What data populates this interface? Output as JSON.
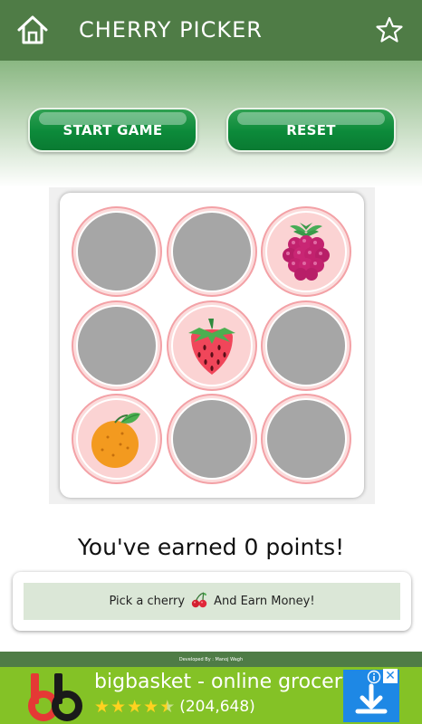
{
  "header": {
    "title": "CHERRY PICKER",
    "home_icon": "home-icon",
    "star_icon": "star-outline-icon",
    "background": "#4f7c46"
  },
  "controls": {
    "start_label": "START GAME",
    "reset_label": "RESET",
    "accent": "#0c8a3a"
  },
  "board": {
    "cells": [
      {
        "state": "hidden"
      },
      {
        "state": "hidden"
      },
      {
        "state": "revealed",
        "fruit": "raspberry"
      },
      {
        "state": "hidden"
      },
      {
        "state": "revealed",
        "fruit": "strawberry"
      },
      {
        "state": "hidden"
      },
      {
        "state": "revealed",
        "fruit": "orange"
      },
      {
        "state": "hidden"
      },
      {
        "state": "hidden"
      }
    ]
  },
  "score_text": "You've earned 0 points!",
  "promo": {
    "text_before": "Pick a cherry",
    "icon": "cherry-icon",
    "text_after": "And Earn Money!"
  },
  "footer": {
    "credit": "Developed By : Manoj Wagh"
  },
  "ad": {
    "title": "bigbasket - online grocery",
    "rating_count": "(204,648)",
    "rating": 4.5,
    "logo_icon": "bigbasket-logo",
    "download_icon": "download-icon",
    "info_icon": "ad-info-icon",
    "close_icon": "ad-close-icon"
  }
}
